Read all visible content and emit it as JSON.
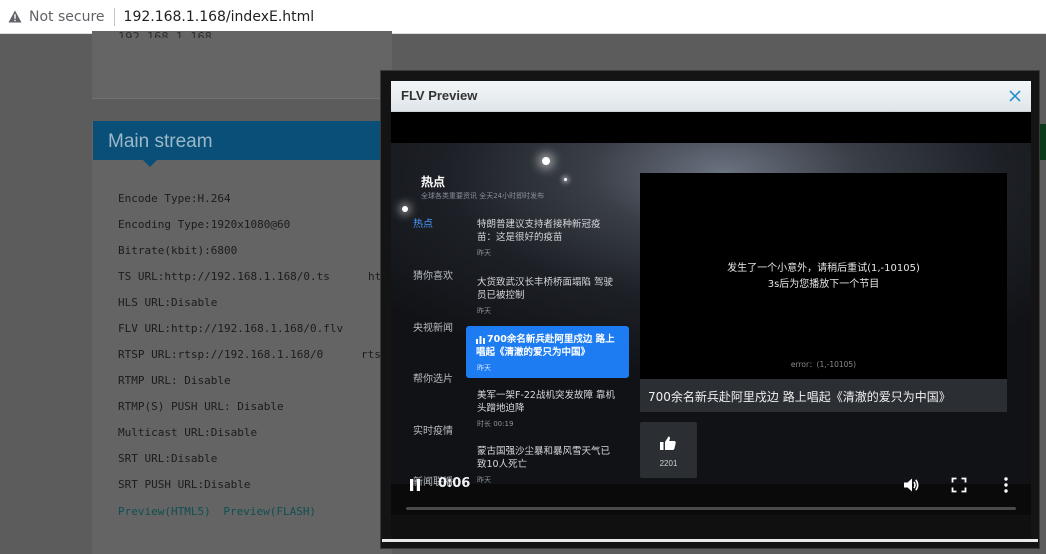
{
  "browser": {
    "security_label": "Not secure",
    "url": "192.168.1.168/indexE.html"
  },
  "page": {
    "main_stream": {
      "title": "Main stream",
      "lines": [
        "Encode Type:H.264",
        "Encoding Type:1920x1080@60",
        "Bitrate(kbit):6800",
        "TS URL:http://192.168.1.168/0.ts",
        "HLS URL:Disable",
        "FLV URL:http://192.168.1.168/0.flv",
        "RTSP URL:rtsp://192.168.1.168/0",
        "RTMP URL: Disable",
        "RTMP(S) PUSH URL: Disable",
        "Multicast URL:Disable",
        "SRT URL:Disable",
        "SRT PUSH URL:Disable"
      ],
      "overflow": {
        "ts": "ht",
        "flv": "h",
        "rtsp": "rtsp"
      },
      "links": {
        "html5": "Preview(HTML5)",
        "flash": "Preview(FLASH)"
      }
    }
  },
  "modal": {
    "title": "FLV Preview",
    "close_icon": "close-icon"
  },
  "player": {
    "feed": {
      "title": "热点",
      "subtitle": "全球各类重要资讯 全天24小时即时发布"
    },
    "categories": [
      {
        "label": "热点",
        "active": true
      },
      {
        "label": "猜你喜欢",
        "active": false
      },
      {
        "label": "央视新闻",
        "active": false
      },
      {
        "label": "帮你选片",
        "active": false
      },
      {
        "label": "实时疫情",
        "active": false
      },
      {
        "label": "新闻联播",
        "active": false
      }
    ],
    "news": [
      {
        "title": "特朗普建议支持者接种新冠疫苗：这是很好的疫苗",
        "meta": "昨天"
      },
      {
        "title": "大货致武汉长丰桥桥面塌陷 驾驶员已被控制",
        "meta": "昨天"
      },
      {
        "title": "700余名新兵赴阿里戍边 路上唱起《清澈的爱只为中国》",
        "meta": "昨天",
        "active": true
      },
      {
        "title": "美军一架F-22战机突发故障 靠机头蹭地迫降",
        "meta": "时长 00:19"
      },
      {
        "title": "蒙古国强沙尘暴和暴风雪天气已致10人死亡",
        "meta": "昨天"
      }
    ],
    "error": {
      "line1": "发生了一个小意外，请稍后重试(1,-10105)",
      "line2": "3s后为您播放下一个节目",
      "code": "error：(1,-10105)"
    },
    "caption": "700余名新兵赴阿里戍边 路上唱起《清澈的爱只为中国》",
    "likes": "2201",
    "time": "0:06",
    "progress": 0.0,
    "icons": {
      "pause": "pause-icon",
      "volume": "volume-icon",
      "fullscreen": "fullscreen-icon",
      "more": "more-vert-icon",
      "like": "thumbs-up-icon",
      "active_news": "audio-bars-icon",
      "warning": "warning-triangle-icon"
    }
  }
}
